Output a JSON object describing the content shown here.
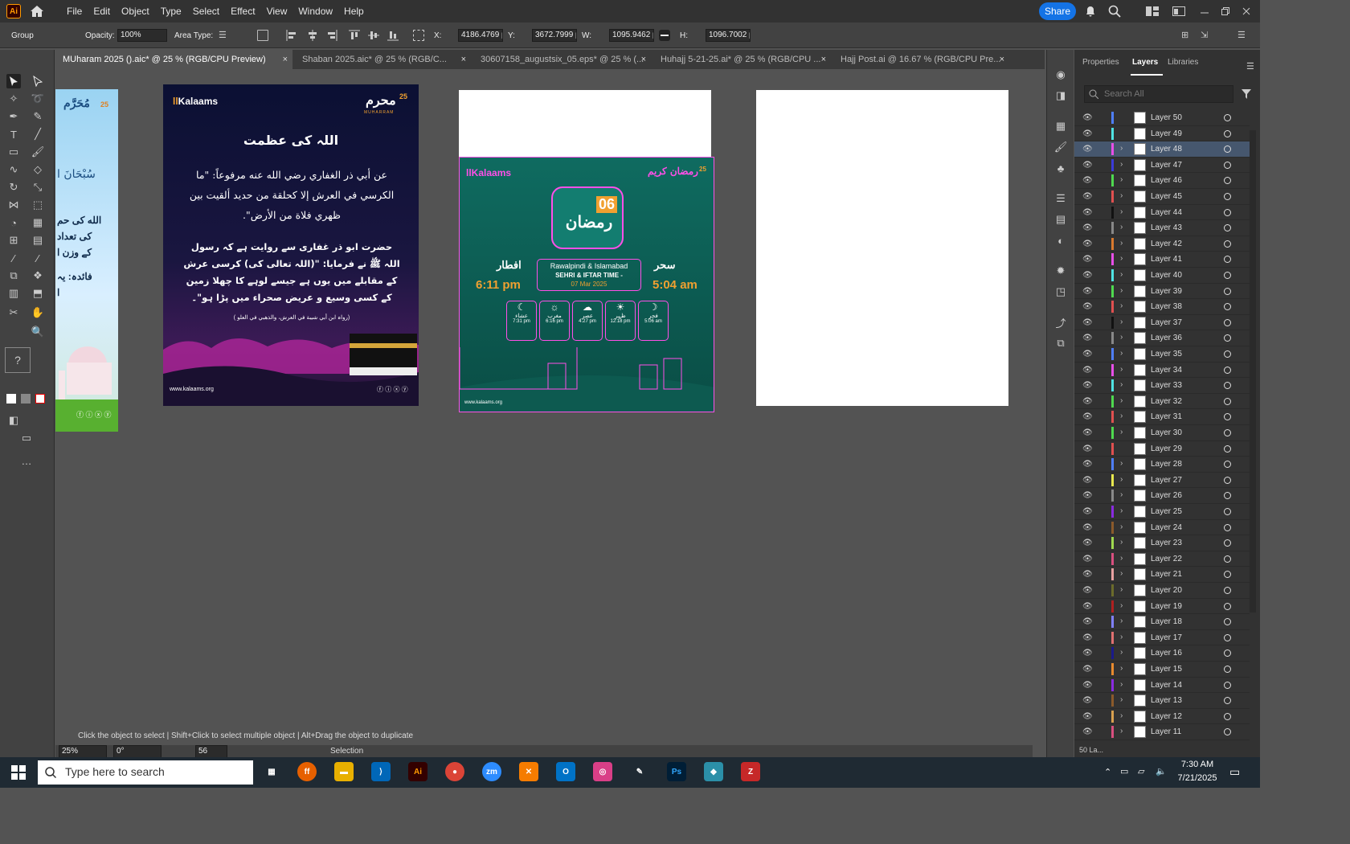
{
  "app": {
    "logo_text": "Ai",
    "share_label": "Share"
  },
  "menu": [
    "File",
    "Edit",
    "Object",
    "Type",
    "Select",
    "Effect",
    "View",
    "Window",
    "Help"
  ],
  "control": {
    "selection_label": "Group",
    "opacity_label": "Opacity:",
    "opacity_value": "100%",
    "area_type_label": "Area Type:",
    "x_label": "X:",
    "x_value": "4186.4769 p",
    "y_label": "Y:",
    "y_value": "3672.7999 p",
    "w_label": "W:",
    "w_value": "1095.9462 p",
    "h_label": "H:",
    "h_value": "1096.7002 p"
  },
  "tabs": [
    {
      "label": "MUharam 2025 ().aic* @ 25 % (RGB/CPU Preview)",
      "close": "×"
    },
    {
      "label": "Shaban 2025.aic* @ 25 % (RGB/C...",
      "close": "×"
    },
    {
      "label": "30607158_augustsix_05.eps* @ 25 % (...",
      "close": "×"
    },
    {
      "label": "Huhajj 5-21-25.ai* @ 25 % (RGB/CPU ...",
      "close": "×"
    },
    {
      "label": "Hajj Post.ai @ 16.67 % (RGB/CPU Pre...",
      "close": "×"
    }
  ],
  "artboards": {
    "muharram_partial": {
      "logo": "مُحَرَّم",
      "badge": "25",
      "line1": "سُبْحَانَ ا",
      "line2": "الله کی حم",
      "line3": "کی تعداد",
      "line4": "کے وزن ا",
      "line5": "فائدہ: یہ",
      "line6": "ا"
    },
    "post": {
      "brand": "Kalaams",
      "logo": "محرم",
      "badge": "25",
      "sub": "MUHARRAM",
      "title": "اللہ کی عظمت",
      "arabic": "عن أبي ذر الغفاري رضي الله عنه مرفوعاً: \"ما الكرسي في العرش إلا كحلقة من حديد ألقيت بين ظهري فلاة من الأرض\".",
      "urdu": "حضرت ابو ذر غفاری سے روایت ہے کہ رسول اللہ ﷺ نے فرمایا: \"(اللہ تعالی کی) کرسی عرش کے مقابلے میں یوں ہے جیسے لوہے کا چھلا زمین کے کسی وسیع و عریض صحراء میں پڑا ہو\"۔",
      "ref": "(رواہ ابن أبي شيبة في العرش، والذهبي في العلو )",
      "url": "www.kalaams.org",
      "social": "ⓕ ⓘ ⓧ ⓨ"
    },
    "ramadan": {
      "brand": "Kalaams",
      "logo": "رمضان کریم",
      "badge": "25",
      "day": "06",
      "month": "رمضان",
      "iftar_label": "افطار",
      "iftar_time": "6:11 pm",
      "sehri_label": "سحر",
      "sehri_time": "5:04 am",
      "city": "Rawalpindi & Islamabad",
      "heading": "SEHRI & IFTAR TIME -",
      "date": "07 Mar 2025",
      "prayers": [
        {
          "name": "عشاء",
          "time": "7:31 pm"
        },
        {
          "name": "مغرب",
          "time": "6:16 pm"
        },
        {
          "name": "عصر",
          "time": "4:27 pm"
        },
        {
          "name": "ظہر",
          "time": "12:18 pm"
        },
        {
          "name": "فجر",
          "time": "5:06 am"
        }
      ],
      "url": "www.kalaams.org"
    }
  },
  "status": {
    "hint": "Click the object to select  |  Shift+Click to select multiple object  |  Alt+Drag the object to duplicate",
    "zoom": "25%",
    "rotation": "0°",
    "artboard": "56",
    "tool": "Selection"
  },
  "panel": {
    "tabs": [
      "Properties",
      "Layers",
      "Libraries"
    ],
    "search_placeholder": "Search All",
    "layer_count": "50 La...",
    "layers": [
      {
        "name": "Layer 50",
        "color": "#4f7fff",
        "expand": false
      },
      {
        "name": "Layer 49",
        "color": "#4fe3e3",
        "expand": false
      },
      {
        "name": "Layer 48",
        "color": "#e84fe8",
        "expand": true,
        "selected": true
      },
      {
        "name": "Layer 47",
        "color": "#3b3bd9",
        "expand": true
      },
      {
        "name": "Layer 46",
        "color": "#4fd94f",
        "expand": true
      },
      {
        "name": "Layer 45",
        "color": "#e05050",
        "expand": true
      },
      {
        "name": "Layer 44",
        "color": "#111111",
        "expand": true
      },
      {
        "name": "Layer 43",
        "color": "#888888",
        "expand": true
      },
      {
        "name": "Layer 42",
        "color": "#d97a2e",
        "expand": true
      },
      {
        "name": "Layer 41",
        "color": "#e84fe8",
        "expand": true
      },
      {
        "name": "Layer 40",
        "color": "#4fe3e3",
        "expand": true
      },
      {
        "name": "Layer 39",
        "color": "#4fd94f",
        "expand": true
      },
      {
        "name": "Layer 38",
        "color": "#e05050",
        "expand": true
      },
      {
        "name": "Layer 37",
        "color": "#111111",
        "expand": true
      },
      {
        "name": "Layer 36",
        "color": "#888888",
        "expand": true
      },
      {
        "name": "Layer 35",
        "color": "#4f7fff",
        "expand": true
      },
      {
        "name": "Layer 34",
        "color": "#e84fe8",
        "expand": true
      },
      {
        "name": "Layer 33",
        "color": "#4fe3e3",
        "expand": true
      },
      {
        "name": "Layer 32",
        "color": "#4fd94f",
        "expand": true
      },
      {
        "name": "Layer 31",
        "color": "#e05050",
        "expand": true
      },
      {
        "name": "Layer 30",
        "color": "#4fd94f",
        "expand": true
      },
      {
        "name": "Layer 29",
        "color": "#e05050",
        "expand": false
      },
      {
        "name": "Layer 28",
        "color": "#4f7fff",
        "expand": true
      },
      {
        "name": "Layer 27",
        "color": "#e8e84f",
        "expand": true
      },
      {
        "name": "Layer 26",
        "color": "#888888",
        "expand": true
      },
      {
        "name": "Layer 25",
        "color": "#8a2be2",
        "expand": true
      },
      {
        "name": "Layer 24",
        "color": "#8b5a2b",
        "expand": true
      },
      {
        "name": "Layer 23",
        "color": "#a0d94f",
        "expand": true
      },
      {
        "name": "Layer 22",
        "color": "#d94f7f",
        "expand": true
      },
      {
        "name": "Layer 21",
        "color": "#e8a0a0",
        "expand": true
      },
      {
        "name": "Layer 20",
        "color": "#6b6b2b",
        "expand": true
      },
      {
        "name": "Layer 19",
        "color": "#b02020",
        "expand": true
      },
      {
        "name": "Layer 18",
        "color": "#8080ff",
        "expand": true
      },
      {
        "name": "Layer 17",
        "color": "#e07070",
        "expand": true
      },
      {
        "name": "Layer 16",
        "color": "#1a1a8a",
        "expand": true
      },
      {
        "name": "Layer 15",
        "color": "#e88a2e",
        "expand": true
      },
      {
        "name": "Layer 14",
        "color": "#8a2be2",
        "expand": true
      },
      {
        "name": "Layer 13",
        "color": "#8b5a2b",
        "expand": true
      },
      {
        "name": "Layer 12",
        "color": "#d9a04f",
        "expand": true
      },
      {
        "name": "Layer 11",
        "color": "#d94f7f",
        "expand": true
      }
    ]
  },
  "taskbar": {
    "search_placeholder": "Type here to search",
    "time": "7:30 AM",
    "date": "7/21/2025"
  }
}
